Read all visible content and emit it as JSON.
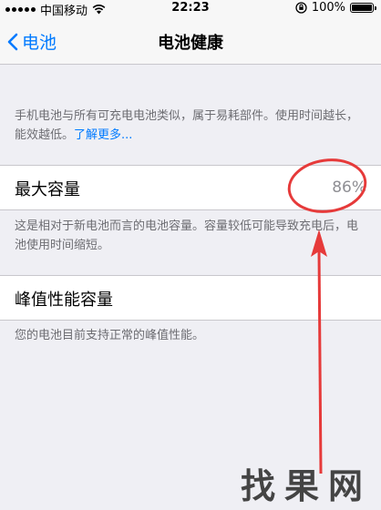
{
  "status_bar": {
    "carrier": "中国移动",
    "time": "22:23",
    "battery": "100%"
  },
  "nav": {
    "back_label": "电池",
    "title": "电池健康"
  },
  "intro": {
    "text": "手机电池与所有可充电电池类似，属于易耗部件。使用时间越长，能效越低。",
    "link": "了解更多..."
  },
  "max_capacity": {
    "label": "最大容量",
    "value": "86%",
    "description": "这是相对于新电池而言的电池容量。容量较低可能导致充电后，电池使用时间缩短。"
  },
  "peak_performance": {
    "label": "峰值性能容量",
    "description": "您的电池目前支持正常的峰值性能。"
  },
  "watermark": "找果网",
  "colors": {
    "accent": "#007aff",
    "annotation": "#e63a3a",
    "background": "#efeff4"
  }
}
